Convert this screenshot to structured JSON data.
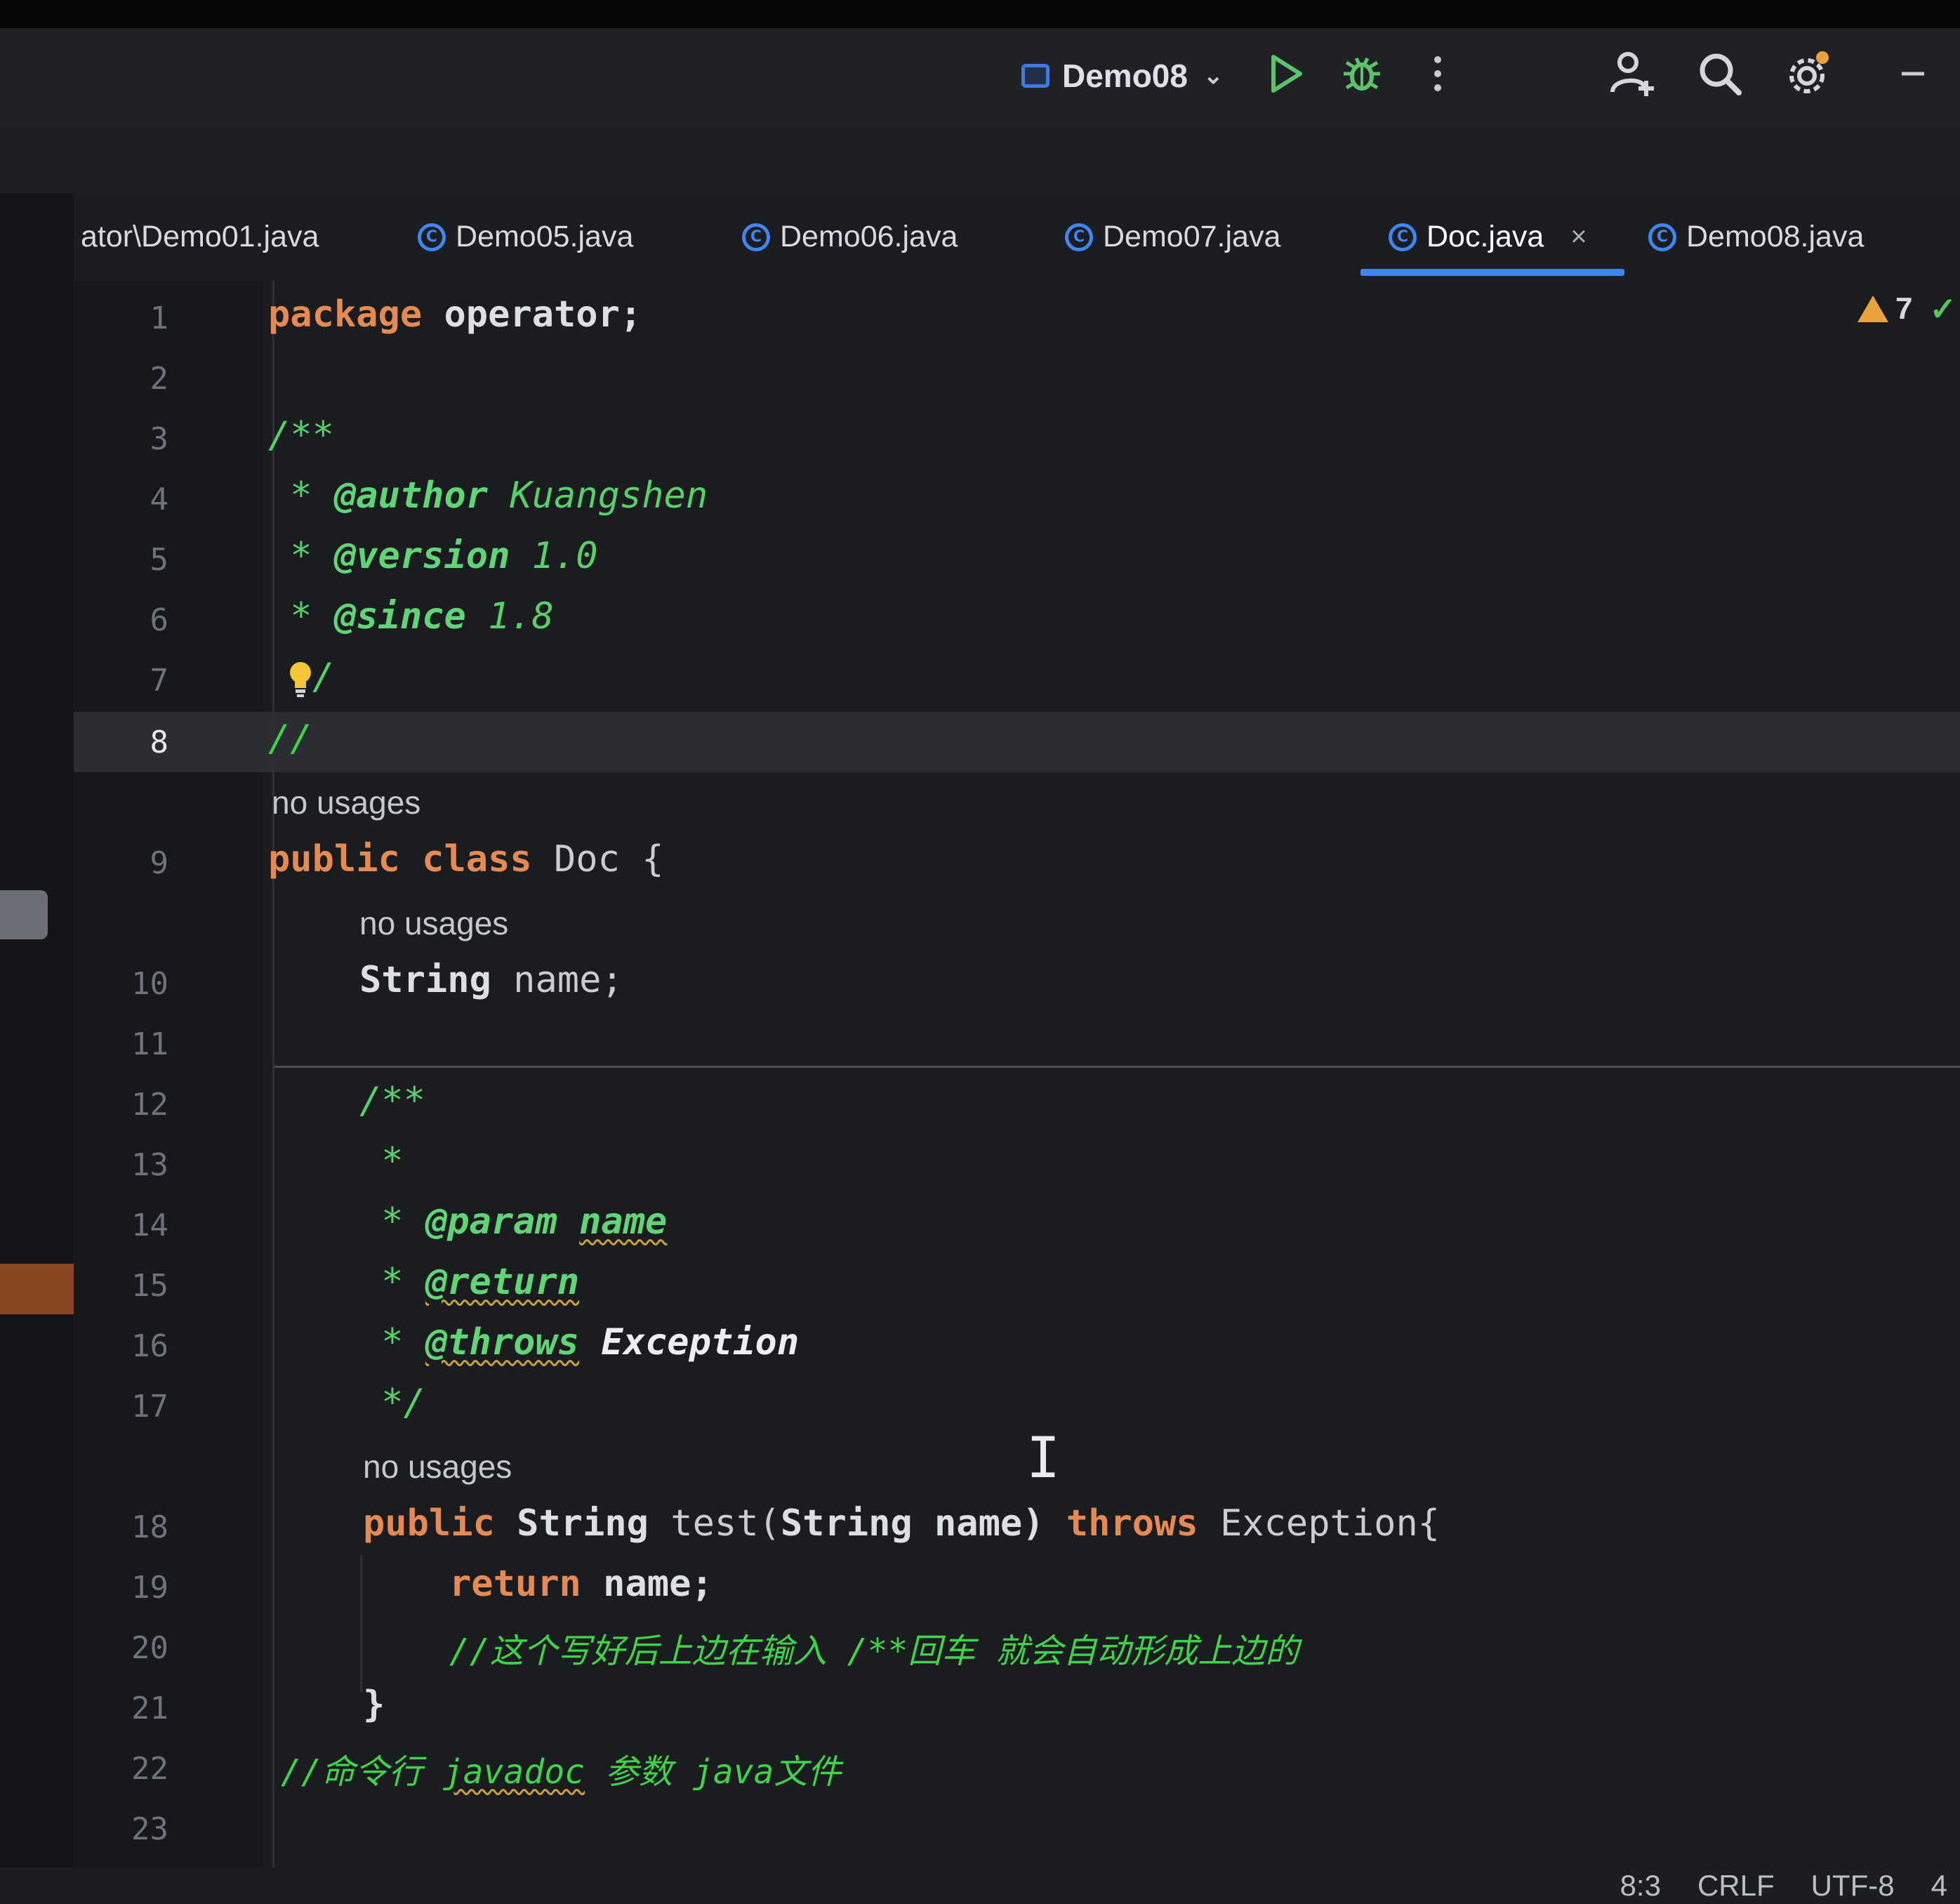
{
  "toolbar": {
    "run_config": "Demo08",
    "icons": [
      "run-icon",
      "debug-icon",
      "more-icon",
      "add-user-icon",
      "search-icon",
      "settings-icon",
      "minimize-icon"
    ]
  },
  "tabs": [
    {
      "label": "ator\\Demo01.java",
      "active": false
    },
    {
      "label": "Demo05.java",
      "active": false
    },
    {
      "label": "Demo06.java",
      "active": false
    },
    {
      "label": "Demo07.java",
      "active": false
    },
    {
      "label": "Doc.java",
      "active": true,
      "close": "×"
    },
    {
      "label": "Demo08.java",
      "active": false
    }
  ],
  "inspections": {
    "warnings": "7"
  },
  "line_numbers": [
    "1",
    "2",
    "3",
    "4",
    "5",
    "6",
    "7",
    "8",
    "9",
    "10",
    "11",
    "12",
    "13",
    "14",
    "15",
    "16",
    "17",
    "18",
    "19",
    "20",
    "21",
    "22",
    "23"
  ],
  "current_line": "8",
  "code": {
    "l1_kw": "package",
    "l1_rest": " operator;",
    "l3": "/**",
    "l4_star": " * ",
    "l4_tag": "@author",
    "l4_text": " Kuangshen",
    "l5_star": " * ",
    "l5_tag": "@version",
    "l5_text": " 1.0",
    "l6_star": " * ",
    "l6_tag": "@since",
    "l6_text": " 1.8",
    "l7": "/",
    "l8": "//",
    "hint_class": "no usages",
    "l9_kw": "public class",
    "l9_rest": " Doc {",
    "hint_field": "no usages",
    "l10_type": "String",
    "l10_rest": " name;",
    "l12": "/**",
    "l13": " *",
    "l14_star": " * ",
    "l14_tag": "@param",
    "l14_name": "name",
    "l15_star": " * ",
    "l15_tag": "@return",
    "l16_star": " * ",
    "l16_tag": "@throws",
    "l16_text": " Exception",
    "l17": " */",
    "hint_method": "no usages",
    "l18_kw1": "public",
    "l18_type1": " String",
    "l18_mid": " test(",
    "l18_type2": "String",
    "l18_param": " name)",
    "l18_kw2": " throws",
    "l18_rest": " Exception{",
    "l19_kw": "return",
    "l19_rest": " name;",
    "l20": "//这个写好后上边在输入 /**回车 就会自动形成上边的",
    "l21": "}",
    "l22_a": "//命令行 ",
    "l22_b": "javadoc",
    "l22_c": " 参数 java文件"
  },
  "status": {
    "position": "8:3",
    "line_sep": "CRLF",
    "encoding": "UTF-8",
    "indent": "4"
  },
  "colors": {
    "keyword": "#e58a52",
    "doc_comment": "#57d06a",
    "line_comment": "#3fd34a",
    "accent": "#3f86f0",
    "warning": "#e8a33c"
  }
}
